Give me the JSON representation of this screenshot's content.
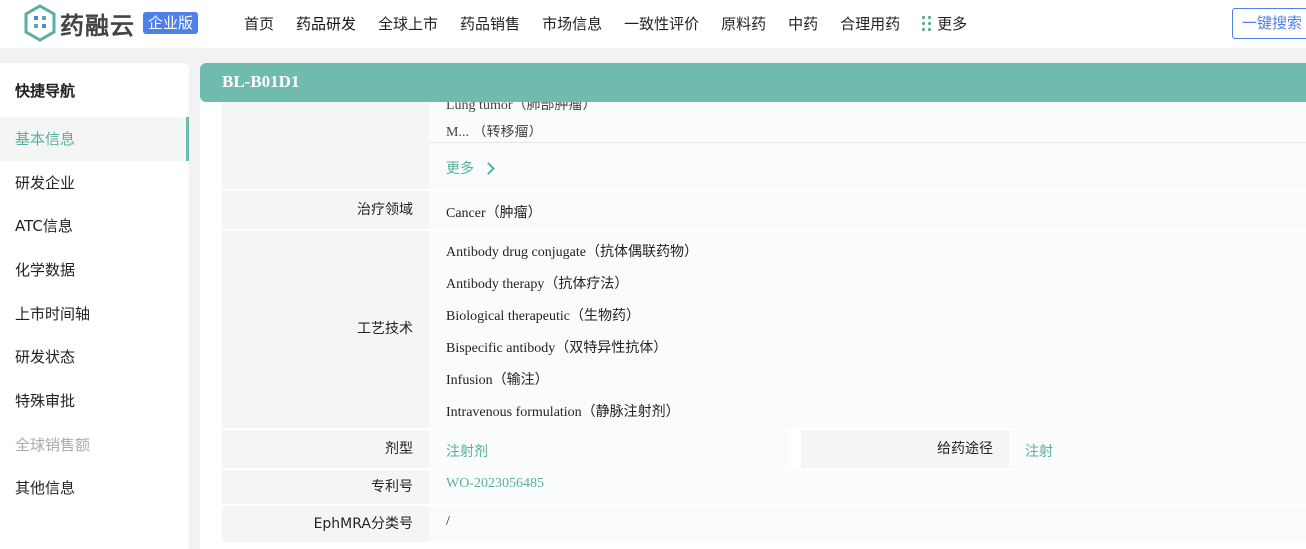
{
  "app": {
    "logo_text": "药融云",
    "logo_badge": "企业版"
  },
  "nav": {
    "items": [
      "首页",
      "药品研发",
      "全球上市",
      "药品销售",
      "市场信息",
      "一致性评价",
      "原料药",
      "中药",
      "合理用药"
    ],
    "more_label": "更多",
    "search_label": "一键搜索"
  },
  "sidebar": {
    "title": "快捷导航",
    "items": [
      {
        "label": "基本信息"
      },
      {
        "label": "研发企业"
      },
      {
        "label": "ATC信息"
      },
      {
        "label": "化学数据"
      },
      {
        "label": "上市时间轴"
      },
      {
        "label": "研发状态"
      },
      {
        "label": "特殊审批"
      },
      {
        "label": "全球销售额"
      },
      {
        "label": "其他信息"
      }
    ]
  },
  "main": {
    "title": "BL-B01D1",
    "indications_partial": [
      "Lung tumor（肺部肿瘤）",
      "M... （转移瘤）"
    ],
    "more_label": "更多",
    "therapeutic_area_label": "治疗领域",
    "therapeutic_area_value": "Cancer（肿瘤）",
    "technology_label": "工艺技术",
    "technologies": [
      "Antibody drug conjugate（抗体偶联药物）",
      "Antibody therapy（抗体疗法）",
      "Biological therapeutic（生物药）",
      "Bispecific antibody（双特异性抗体）",
      "Infusion（输注）",
      "Intravenous formulation（静脉注射剂）"
    ],
    "dosage_form_label": "剂型",
    "dosage_form_value": "注射剂",
    "route_label": "给药途径",
    "route_value": "注射",
    "patent_label": "专利号",
    "patent_value": "WO-2023056485",
    "ephmra_label": "EphMRA分类号",
    "ephmra_value": "/"
  },
  "colors": {
    "accent": "#6fbcae",
    "link": "#5aaea0",
    "brand_blue": "#4f7fe8"
  }
}
